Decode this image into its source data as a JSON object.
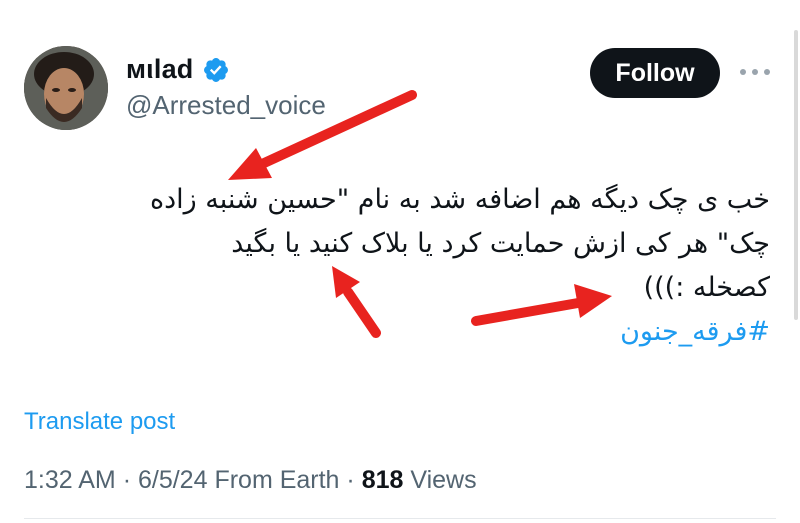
{
  "user": {
    "name": "мιlad",
    "handle": "@Arrested_voice",
    "verified": true
  },
  "header": {
    "follow_label": "Follow"
  },
  "tweet": {
    "lines": [
      "خب ی چک دیگه هم اضافه شد به نام \"حسین شنبه زاده",
      "چک\" هر کی ازش حمایت کرد  یا بلاک کنید یا بگید",
      "کصخله :)))"
    ],
    "hashtag": "#فرقه_جنون"
  },
  "translate_label": "Translate post",
  "meta": {
    "time": "1:32 AM",
    "date": "6/5/24",
    "source": "From Earth",
    "views_count": "818",
    "views_label": "Views"
  },
  "colors": {
    "accent": "#1d9bf0",
    "text": "#0f1419",
    "muted": "#536471",
    "arrow": "#e8231f"
  },
  "icons": [
    "verified-badge-icon",
    "more-options-icon"
  ]
}
